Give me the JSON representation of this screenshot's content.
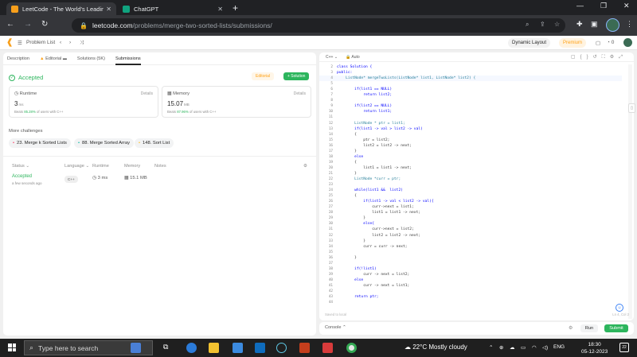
{
  "browser": {
    "tabs": [
      {
        "title": "LeetCode - The World's Leading",
        "active": true
      },
      {
        "title": "ChatGPT",
        "active": false
      }
    ],
    "url_host": "leetcode.com",
    "url_path": "/problems/merge-two-sorted-lists/submissions/"
  },
  "lc_nav": {
    "problem_list": "Problem List",
    "dynamic_layout": "Dynamic Layout",
    "premium": "Premium",
    "streak": "0"
  },
  "left": {
    "tabs": [
      "Description",
      "Editorial",
      "Solutions (5K)",
      "Submissions"
    ],
    "status": "Accepted",
    "editorial_btn": "Editorial",
    "solution_btn": "+ Solution",
    "runtime": {
      "label": "Runtime",
      "details": "Details",
      "value": "3",
      "unit": "ms",
      "beats_prefix": "Beats ",
      "beats_pct": "85.28%",
      "beats_suffix": " of users with C++"
    },
    "memory": {
      "label": "Memory",
      "details": "Details",
      "value": "15.07",
      "unit": "MB",
      "beats_prefix": "Beats ",
      "beats_pct": "87.96%",
      "beats_suffix": " of users with C++"
    },
    "more_challenges": "More challenges",
    "challenges": [
      "23. Merge k Sorted Lists",
      "88. Merge Sorted Array",
      "148. Sort List"
    ],
    "table_headers": [
      "Status",
      "Language",
      "Runtime",
      "Memory",
      "Notes"
    ],
    "row": {
      "status": "Accepted",
      "ago": "a few seconds ago",
      "language": "C++",
      "runtime": "3 ms",
      "memory": "15.1 MB"
    }
  },
  "editor": {
    "language": "C++",
    "auto": "Auto",
    "lines": [
      {
        "n": "2",
        "t": "class Solution {"
      },
      {
        "n": "3",
        "t": "public:"
      },
      {
        "n": "4",
        "t": "    ListNode* mergeTwoLists(ListNode* list1, ListNode* list2) {"
      },
      {
        "n": "5",
        "t": ""
      },
      {
        "n": "6",
        "t": "        if(list1 == NULL)"
      },
      {
        "n": "7",
        "t": "            return list2;"
      },
      {
        "n": "8",
        "t": ""
      },
      {
        "n": "9",
        "t": "        if(list2 == NULL)"
      },
      {
        "n": "10",
        "t": "            return list1;"
      },
      {
        "n": "11",
        "t": ""
      },
      {
        "n": "12",
        "t": "        ListNode * ptr = list1;"
      },
      {
        "n": "13",
        "t": "        if(list1 -> val > list2 -> val)"
      },
      {
        "n": "14",
        "t": "        {"
      },
      {
        "n": "15",
        "t": "            ptr = list2;"
      },
      {
        "n": "16",
        "t": "            list2 = list2 -> next;"
      },
      {
        "n": "17",
        "t": "        }"
      },
      {
        "n": "18",
        "t": "        else"
      },
      {
        "n": "19",
        "t": "        {"
      },
      {
        "n": "20",
        "t": "            list1 = list1 -> next;"
      },
      {
        "n": "21",
        "t": "        }"
      },
      {
        "n": "22",
        "t": "        ListNode *curr = ptr;"
      },
      {
        "n": "23",
        "t": ""
      },
      {
        "n": "24",
        "t": "        while(list1 &&  list2)"
      },
      {
        "n": "25",
        "t": "        {"
      },
      {
        "n": "26",
        "t": "            if(list1 -> val < list2 -> val){"
      },
      {
        "n": "27",
        "t": "                curr->next = list1;"
      },
      {
        "n": "28",
        "t": "                list1 = list1 -> next;"
      },
      {
        "n": "29",
        "t": "            }"
      },
      {
        "n": "30",
        "t": "            else{"
      },
      {
        "n": "31",
        "t": "                curr->next = list2;"
      },
      {
        "n": "32",
        "t": "                list2 = list2 -> next;"
      },
      {
        "n": "33",
        "t": "            }"
      },
      {
        "n": "34",
        "t": "            curr = curr -> next;"
      },
      {
        "n": "35",
        "t": ""
      },
      {
        "n": "36",
        "t": "        }"
      },
      {
        "n": "37",
        "t": ""
      },
      {
        "n": "38",
        "t": "        if(!list1)"
      },
      {
        "n": "39",
        "t": "            curr -> next = list2;"
      },
      {
        "n": "40",
        "t": "        else"
      },
      {
        "n": "41",
        "t": "            curr -> next = list1;"
      },
      {
        "n": "42",
        "t": ""
      },
      {
        "n": "43",
        "t": "        return ptr;"
      },
      {
        "n": "44",
        "t": ""
      }
    ],
    "saved": "Saved to local",
    "position": "Ln 4, Col 2"
  },
  "console": {
    "label": "Console",
    "run": "Run",
    "submit": "Submit"
  },
  "taskbar": {
    "search_placeholder": "Type here to search",
    "weather": "22°C  Mostly cloudy",
    "lang": "ENG",
    "time": "18:30",
    "date": "05-12-2023",
    "notifications": "22"
  },
  "colors": {
    "accent_green": "#2db55d",
    "leetcode_orange": "#ffa116",
    "chrome_dark": "#202124"
  }
}
